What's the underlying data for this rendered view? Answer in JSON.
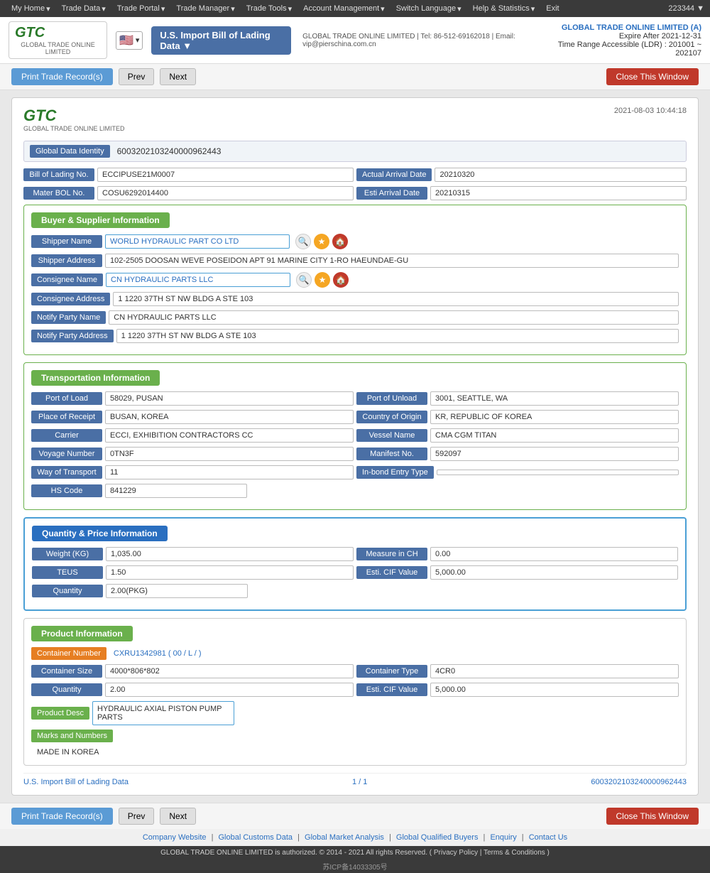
{
  "topnav": {
    "items": [
      {
        "label": "My Home",
        "id": "my-home"
      },
      {
        "label": "Trade Data",
        "id": "trade-data"
      },
      {
        "label": "Trade Portal",
        "id": "trade-portal"
      },
      {
        "label": "Trade Manager",
        "id": "trade-manager"
      },
      {
        "label": "Trade Tools",
        "id": "trade-tools"
      },
      {
        "label": "Account Management",
        "id": "account-management"
      },
      {
        "label": "Switch Language",
        "id": "switch-language"
      },
      {
        "label": "Help & Statistics",
        "id": "help-statistics"
      },
      {
        "label": "Exit",
        "id": "exit"
      }
    ],
    "account_number": "223344 ▼"
  },
  "header": {
    "logo_text": "GTC",
    "logo_sub": "GLOBAL TRADE ONLINE LIMITED",
    "dropdown_label": "U.S. Import Bill of Lading Data ▼",
    "company_line1": "GLOBAL TRADE ONLINE LIMITED | Tel: 86-512-69162018 | Email: vip@pierschina.com.cn",
    "company_name": "GLOBAL TRADE ONLINE LIMITED (A)",
    "expire_label": "Expire After 2021-12-31",
    "time_range": "Time Range Accessible (LDR) : 201001 ~ 202107"
  },
  "toolbar": {
    "print_label": "Print Trade Record(s)",
    "prev_label": "Prev",
    "next_label": "Next",
    "close_label": "Close This Window"
  },
  "card": {
    "date": "2021-08-03 10:44:18",
    "global_data_identity_label": "Global Data Identity",
    "global_data_identity_value": "6003202103240000962443",
    "bill_of_lading_label": "Bill of Lading No.",
    "bill_of_lading_value": "ECCIPUSE21M0007",
    "actual_arrival_label": "Actual Arrival Date",
    "actual_arrival_value": "20210320",
    "mater_bol_label": "Mater BOL No.",
    "mater_bol_value": "COSU6292014400",
    "esti_arrival_label": "Esti Arrival Date",
    "esti_arrival_value": "20210315"
  },
  "buyer_supplier": {
    "section_title": "Buyer & Supplier Information",
    "shipper_name_label": "Shipper Name",
    "shipper_name_value": "WORLD HYDRAULIC PART CO LTD",
    "shipper_address_label": "Shipper Address",
    "shipper_address_value": "102-2505 DOOSAN WEVE POSEIDON APT 91 MARINE CITY 1-RO HAEUNDAE-GU",
    "consignee_name_label": "Consignee Name",
    "consignee_name_value": "CN HYDRAULIC PARTS LLC",
    "consignee_address_label": "Consignee Address",
    "consignee_address_value": "1 1220 37TH ST NW BLDG A STE 103",
    "notify_party_name_label": "Notify Party Name",
    "notify_party_name_value": "CN HYDRAULIC PARTS LLC",
    "notify_party_address_label": "Notify Party Address",
    "notify_party_address_value": "1 1220 37TH ST NW BLDG A STE 103"
  },
  "transportation": {
    "section_title": "Transportation Information",
    "port_of_load_label": "Port of Load",
    "port_of_load_value": "58029, PUSAN",
    "port_of_unload_label": "Port of Unload",
    "port_of_unload_value": "3001, SEATTLE, WA",
    "place_of_receipt_label": "Place of Receipt",
    "place_of_receipt_value": "BUSAN, KOREA",
    "country_of_origin_label": "Country of Origin",
    "country_of_origin_value": "KR, REPUBLIC OF KOREA",
    "carrier_label": "Carrier",
    "carrier_value": "ECCI, EXHIBITION CONTRACTORS CC",
    "vessel_name_label": "Vessel Name",
    "vessel_name_value": "CMA CGM TITAN",
    "voyage_number_label": "Voyage Number",
    "voyage_number_value": "0TN3F",
    "manifest_no_label": "Manifest No.",
    "manifest_no_value": "592097",
    "way_of_transport_label": "Way of Transport",
    "way_of_transport_value": "11",
    "inbond_entry_label": "In-bond Entry Type",
    "inbond_entry_value": "",
    "hs_code_label": "HS Code",
    "hs_code_value": "841229"
  },
  "quantity_price": {
    "section_title": "Quantity & Price Information",
    "weight_label": "Weight (KG)",
    "weight_value": "1,035.00",
    "measure_label": "Measure in CH",
    "measure_value": "0.00",
    "teus_label": "TEUS",
    "teus_value": "1.50",
    "esti_cif_label": "Esti. CIF Value",
    "esti_cif_value": "5,000.00",
    "quantity_label": "Quantity",
    "quantity_value": "2.00(PKG)"
  },
  "product": {
    "section_title": "Product Information",
    "container_number_label": "Container Number",
    "container_number_value": "CXRU1342981 ( 00 / L / )",
    "container_size_label": "Container Size",
    "container_size_value": "4000*806*802",
    "container_type_label": "Container Type",
    "container_type_value": "4CR0",
    "quantity_label": "Quantity",
    "quantity_value": "2.00",
    "esti_cif_label": "Esti. CIF Value",
    "esti_cif_value": "5,000.00",
    "product_desc_label": "Product Desc",
    "product_desc_value": "HYDRAULIC AXIAL PISTON PUMP PARTS",
    "marks_label": "Marks and Numbers",
    "marks_value": "MADE IN KOREA"
  },
  "card_footer": {
    "doc_type": "U.S. Import Bill of Lading Data",
    "page_info": "1 / 1",
    "record_id": "6003202103240000962443"
  },
  "footer": {
    "links": [
      "Company Website",
      "Global Customs Data",
      "Global Market Analysis",
      "Global Qualified Buyers",
      "Enquiry",
      "Contact Us"
    ],
    "copyright": "GLOBAL TRADE ONLINE LIMITED is authorized. © 2014 - 2021 All rights Reserved.  (  Privacy Policy  |  Terms & Conditions  )",
    "icp": "苏ICP备14033305号"
  }
}
